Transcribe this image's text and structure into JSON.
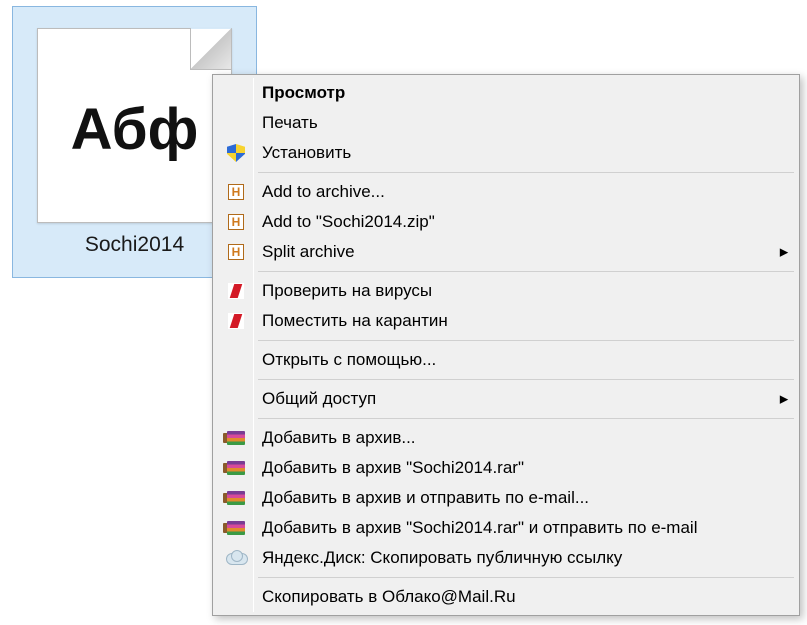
{
  "file": {
    "thumbnail_text": "Абф",
    "label": "Sochi2014"
  },
  "context_menu": {
    "items": [
      {
        "label": "Просмотр",
        "bold": true
      },
      {
        "label": "Печать"
      },
      {
        "label": "Установить",
        "icon": "shield-icon"
      },
      {
        "separator": true
      },
      {
        "label": "Add to archive...",
        "icon": "hamster-icon"
      },
      {
        "label": "Add to \"Sochi2014.zip\"",
        "icon": "hamster-icon"
      },
      {
        "label": "Split archive",
        "icon": "hamster-icon",
        "submenu": true
      },
      {
        "separator": true
      },
      {
        "label": "Проверить на вирусы",
        "icon": "kaspersky-icon"
      },
      {
        "label": "Поместить на карантин",
        "icon": "kaspersky-icon"
      },
      {
        "separator": true
      },
      {
        "label": "Открыть с помощью..."
      },
      {
        "separator": true
      },
      {
        "label": "Общий доступ",
        "submenu": true
      },
      {
        "separator": true
      },
      {
        "label": "Добавить в архив...",
        "icon": "winrar-icon"
      },
      {
        "label": "Добавить в архив \"Sochi2014.rar\"",
        "icon": "winrar-icon"
      },
      {
        "label": "Добавить в архив и отправить по e-mail...",
        "icon": "winrar-icon"
      },
      {
        "label": "Добавить в архив \"Sochi2014.rar\" и отправить по e-mail",
        "icon": "winrar-icon"
      },
      {
        "label": "Яндекс.Диск: Скопировать публичную ссылку",
        "icon": "cloud-icon"
      },
      {
        "separator": true
      },
      {
        "label": "Скопировать в Облако@Mail.Ru"
      }
    ]
  }
}
